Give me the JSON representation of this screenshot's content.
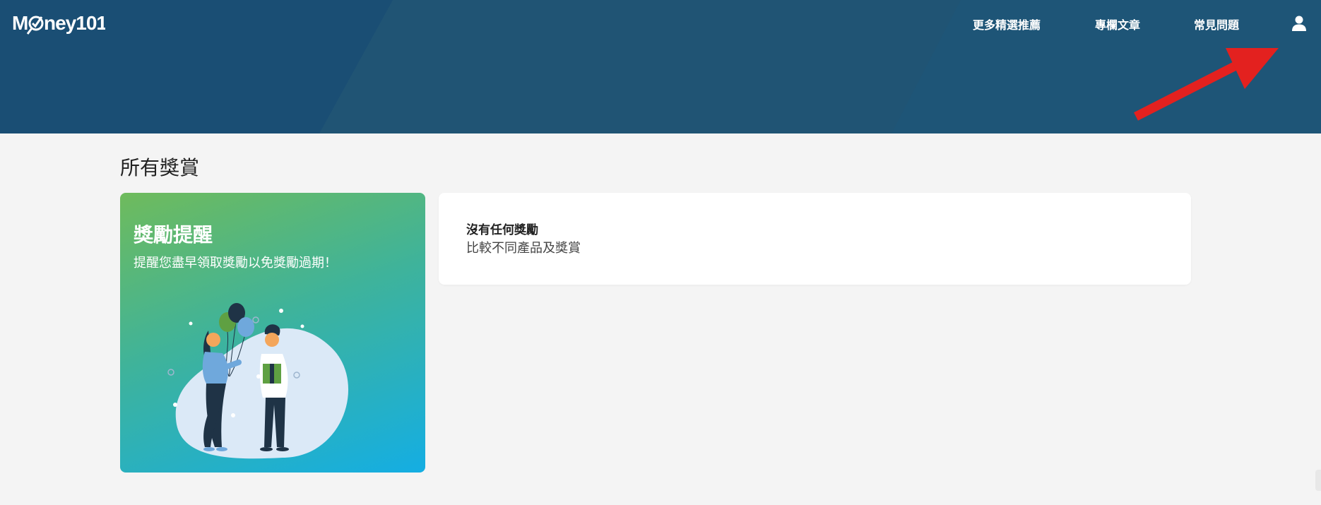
{
  "header": {
    "logo_text": "Money101",
    "nav": [
      "更多精選推薦",
      "專欄文章",
      "常見問題"
    ],
    "user_icon": "user-icon",
    "accent_arrow_color": "#e3211f",
    "background_color": "#205474"
  },
  "main": {
    "title": "所有獎賞",
    "promo": {
      "title": "獎勵提醒",
      "subtitle": "提醒您盡早領取獎勵以免獎勵過期！"
    },
    "empty_state": {
      "title": "沒有任何獎勵",
      "link": "比較不同產品及獎賞"
    }
  }
}
